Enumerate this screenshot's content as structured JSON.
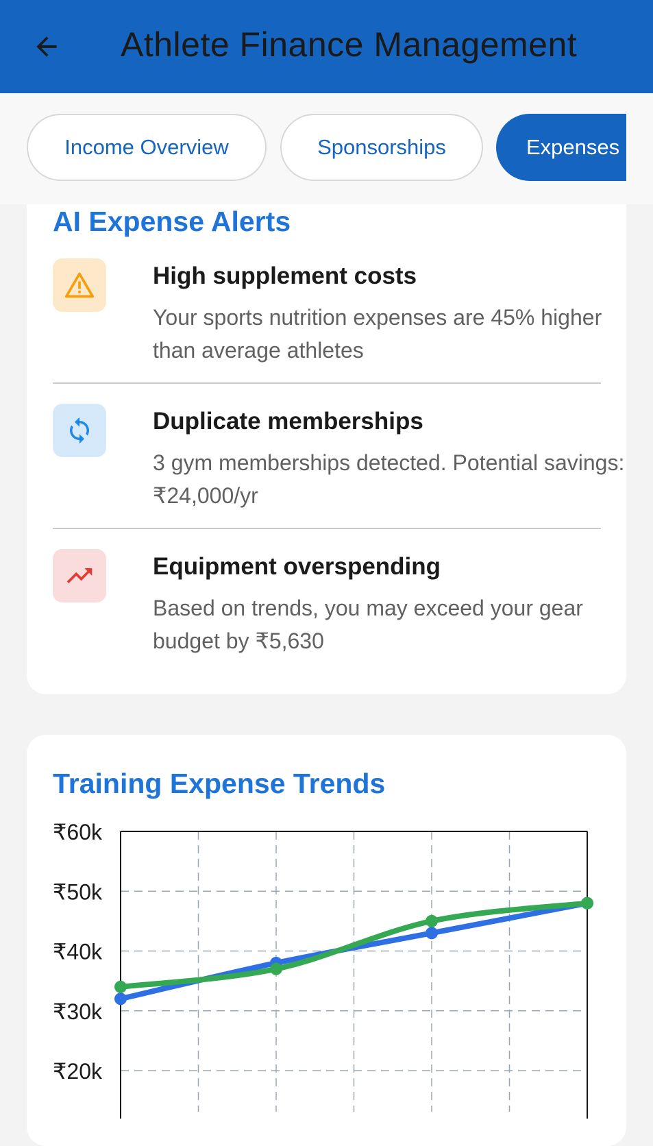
{
  "app": {
    "title": "Athlete Finance Management"
  },
  "tabs": [
    {
      "label": "Income Overview"
    },
    {
      "label": "Sponsorships"
    },
    {
      "label": "Expenses"
    }
  ],
  "alerts": {
    "title": "AI Expense Alerts",
    "items": [
      {
        "icon": "warning-icon",
        "heading": "High supplement costs",
        "text": "Your sports nutrition expenses are 45% higher than average athletes"
      },
      {
        "icon": "sync-icon",
        "heading": "Duplicate memberships",
        "text": "3 gym memberships detected. Potential savings: ₹24,000/yr"
      },
      {
        "icon": "trending-up-icon",
        "heading": "Equipment overspending",
        "text": "Based on trends, you may exceed your gear budget by ₹5,630"
      }
    ]
  },
  "colors": {
    "primary": "#1565c0",
    "accent_title": "#1e74d8",
    "series_blue": "#2f6fe4",
    "series_green": "#34a853",
    "warning_bg": "#fde9c9",
    "warning_fg": "#f59e0b",
    "sync_bg": "#d6e9fb",
    "sync_fg": "#1e88e5",
    "trend_bg": "#fbdcdc",
    "trend_fg": "#e53935"
  },
  "chart_data": {
    "type": "line",
    "title": "Training Expense Trends",
    "yticks": [
      "₹60k",
      "₹50k",
      "₹40k",
      "₹30k",
      "₹20k"
    ],
    "ylim": [
      20000,
      60000
    ],
    "grid": true,
    "x": [
      0,
      1,
      2,
      3
    ],
    "series": [
      {
        "color": "#2f6fe4",
        "values": [
          32000,
          38000,
          43000,
          48000
        ]
      },
      {
        "color": "#34a853",
        "values": [
          34000,
          37000,
          45000,
          48000
        ]
      }
    ]
  }
}
